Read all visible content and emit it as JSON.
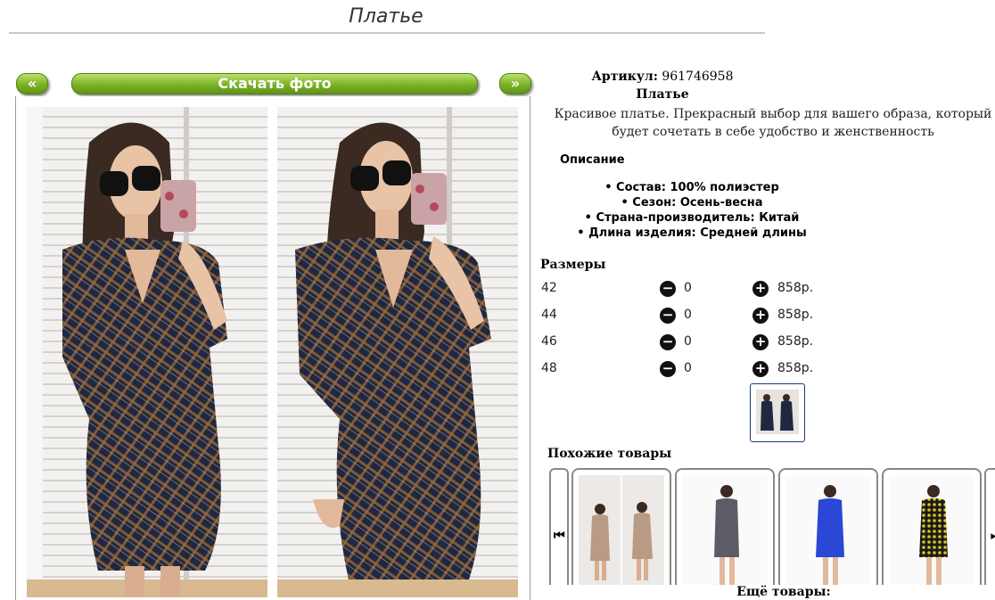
{
  "page": {
    "title": "Платье"
  },
  "gallery": {
    "prev_label": "«",
    "next_label": "»",
    "download_label": "Скачать фото"
  },
  "product": {
    "sku_label": "Артикул:",
    "sku_value": "961746958",
    "name": "Платье",
    "description": "Красивое платье. Прекрасный выбор для вашего образа, который будет сочетать в себе удобство и женственность",
    "description_heading": "Описание",
    "properties": [
      "Состав: 100% полиэстер",
      "Сезон: Осень-весна",
      "Страна-производитель: Китай",
      "Длина изделия: Средней длины"
    ]
  },
  "sizes": {
    "heading": "Размеры",
    "rows": [
      {
        "size": "42",
        "qty": "0",
        "price": "858р."
      },
      {
        "size": "44",
        "qty": "0",
        "price": "858р."
      },
      {
        "size": "46",
        "qty": "0",
        "price": "858р."
      },
      {
        "size": "48",
        "qty": "0",
        "price": "858р."
      }
    ],
    "minus_glyph": "−",
    "plus_glyph": "+"
  },
  "similar": {
    "heading": "Похожие товары",
    "left_glyph": "⏮",
    "right_glyph": "⏭",
    "more_label": "Ещё товары:"
  },
  "colors": {
    "button_green": "#7bb126",
    "plaid_dark": "#1f2840",
    "plaid_rust": "#9b6a3a",
    "card_beige": "#b99a85",
    "card_grey": "#5c5c66",
    "card_blue": "#2b47d6",
    "card_yellow": "#d8c31e"
  }
}
